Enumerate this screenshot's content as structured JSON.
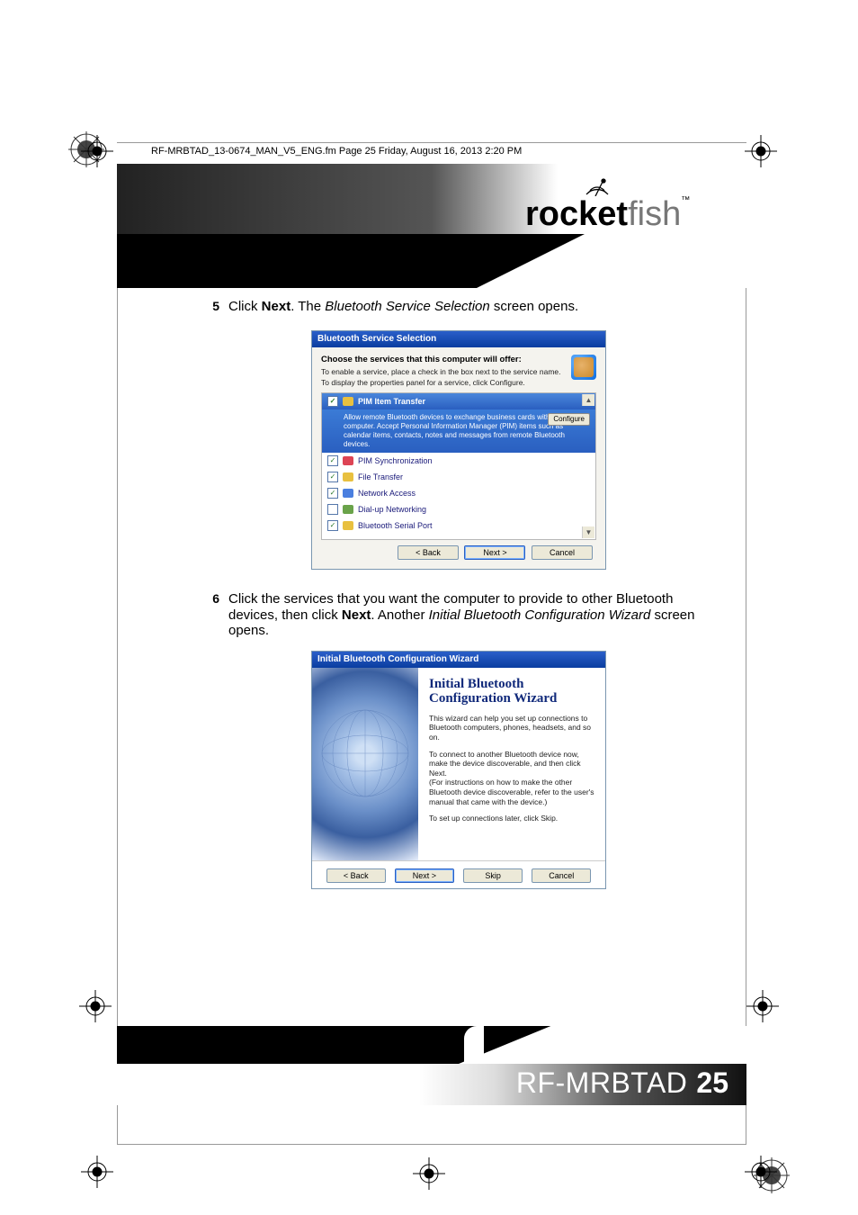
{
  "pdf_header": "RF-MRBTAD_13-0674_MAN_V5_ENG.fm  Page 25  Friday, August 16, 2013  2:20 PM",
  "brand": {
    "part1": "rocket",
    "part2": "fish",
    "tm": "™"
  },
  "steps": {
    "s5": {
      "num": "5",
      "pre": "Click ",
      "bold": "Next",
      "mid": ". The ",
      "ital": "Bluetooth Service Selection",
      "post": " screen opens."
    },
    "s6": {
      "num": "6",
      "line1_pre": "Click the services that you want the computer to provide to other Bluetooth devices, then click ",
      "line1_bold": "Next",
      "line1_mid": ". Another ",
      "line1_ital": "Initial Bluetooth Configuration Wizard",
      "line1_post": " screen opens."
    }
  },
  "dlg1": {
    "title": "Bluetooth Service Selection",
    "head_bold": "Choose the services that this computer will offer:",
    "head_line1": "To enable a service, place a check in the box next to the service name.",
    "head_line2": "To display the properties panel for a service, click Configure.",
    "sel_title": "PIM Item Transfer",
    "sel_desc": "Allow remote Bluetooth devices to exchange business cards with this computer. Accept Personal Information Manager (PIM) items such as calendar items, contacts, notes and messages from remote Bluetooth devices.",
    "configure": "Configure",
    "items": [
      {
        "label": "PIM Synchronization",
        "checked": true,
        "icon": "red"
      },
      {
        "label": "File Transfer",
        "checked": true,
        "icon": "yel"
      },
      {
        "label": "Network Access",
        "checked": true,
        "icon": "blue"
      },
      {
        "label": "Dial-up Networking",
        "checked": false,
        "icon": "grn"
      },
      {
        "label": "Bluetooth Serial Port",
        "checked": true,
        "icon": "yel"
      }
    ],
    "btn_back": "< Back",
    "btn_next": "Next >",
    "btn_cancel": "Cancel"
  },
  "dlg2": {
    "title": "Initial Bluetooth Configuration Wizard",
    "heading": "Initial Bluetooth Configuration Wizard",
    "p1": "This wizard can help you set up connections to Bluetooth computers, phones, headsets, and so on.",
    "p2": "To connect to another Bluetooth device now, make the device discoverable, and then click Next.\n(For instructions on how to make the other Bluetooth device discoverable, refer to the user's manual that came with the device.)",
    "p3": "To set up connections later, click Skip.",
    "btn_back": "< Back",
    "btn_next": "Next >",
    "btn_skip": "Skip",
    "btn_cancel": "Cancel"
  },
  "footer": {
    "model": "RF-MRBTAD",
    "page": "25"
  }
}
